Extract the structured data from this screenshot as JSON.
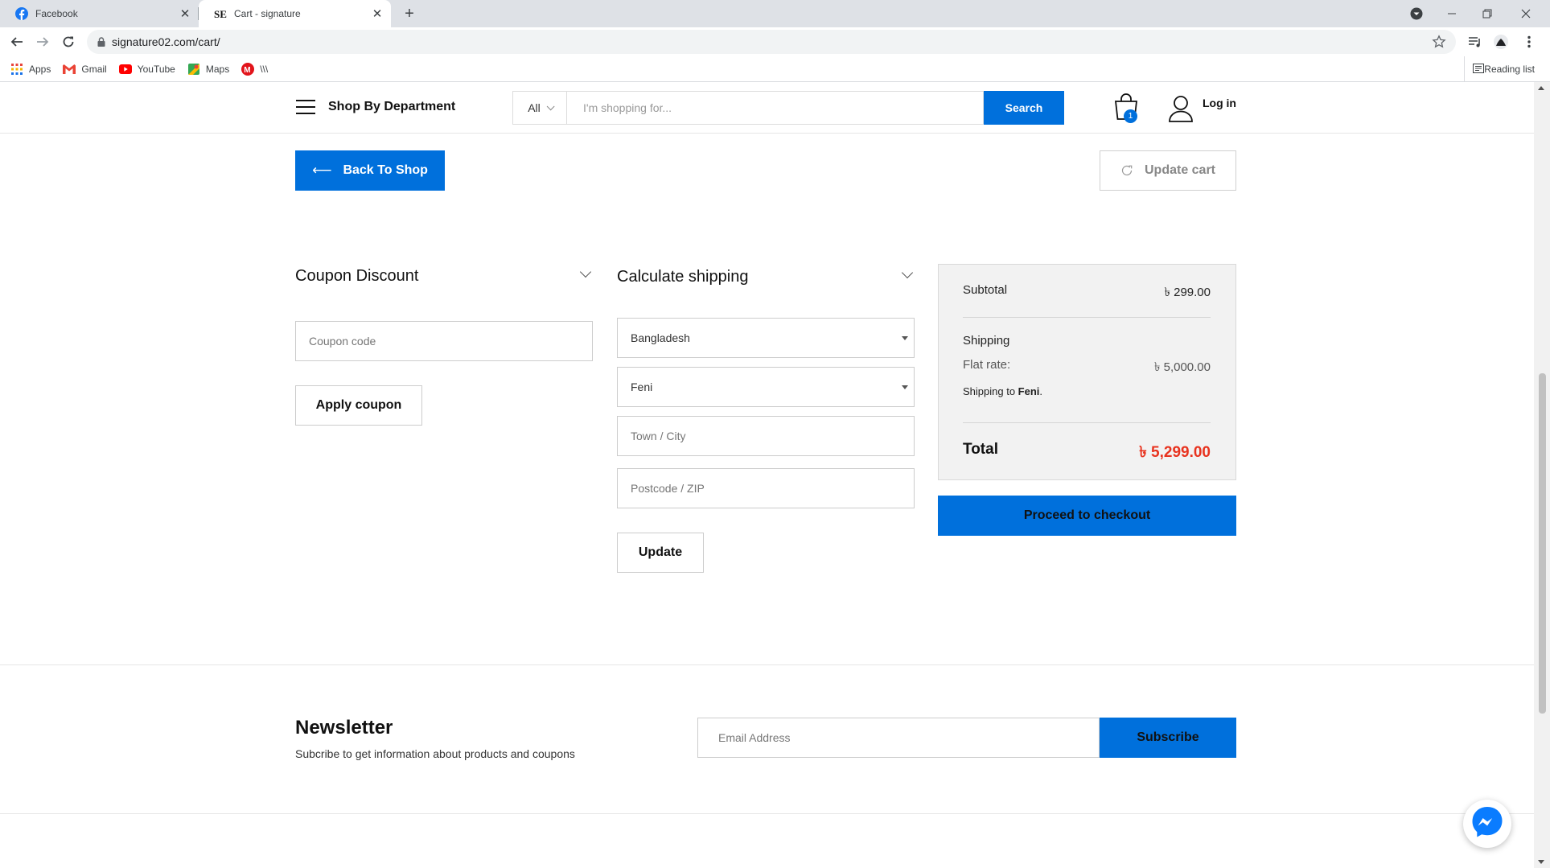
{
  "browser": {
    "tabs": [
      {
        "title": "Facebook",
        "icon": "facebook-icon",
        "active": false
      },
      {
        "title": "Cart - signature",
        "icon": "signature-favicon",
        "active": true
      }
    ],
    "url": "signature02.com/cart/",
    "bookmarks": [
      "Apps",
      "Gmail",
      "YouTube",
      "Maps",
      "\\\\\\"
    ],
    "reading_list": "Reading list"
  },
  "header": {
    "department_label": "Shop By Department",
    "search_category": "All",
    "search_placeholder": "I'm shopping for...",
    "search_button": "Search",
    "cart_count": "1",
    "login_label": "Log in"
  },
  "actions": {
    "back_to_shop": "Back To Shop",
    "update_cart": "Update cart"
  },
  "coupon": {
    "title": "Coupon Discount",
    "placeholder": "Coupon code",
    "apply_label": "Apply coupon"
  },
  "shipping_calc": {
    "title": "Calculate shipping",
    "country": "Bangladesh",
    "state": "Feni",
    "city_placeholder": "Town / City",
    "postcode_placeholder": "Postcode / ZIP",
    "update_label": "Update"
  },
  "totals": {
    "subtotal_label": "Subtotal",
    "subtotal_value": "৳ 299.00",
    "shipping_label": "Shipping",
    "flat_rate_label": "Flat rate:",
    "flat_rate_value": "৳ 5,000.00",
    "shipping_to_prefix": "Shipping to ",
    "shipping_to_place": "Feni",
    "shipping_to_suffix": ".",
    "total_label": "Total",
    "total_value": "৳ 5,299.00",
    "checkout_label": "Proceed to checkout"
  },
  "newsletter": {
    "title": "Newsletter",
    "subtitle": "Subcribe to get information about products and coupons",
    "email_placeholder": "Email Address",
    "subscribe_label": "Subscribe"
  },
  "colors": {
    "accent": "#0070dc",
    "total_red": "#e8331f",
    "messenger_blue": "#0a7cff"
  }
}
